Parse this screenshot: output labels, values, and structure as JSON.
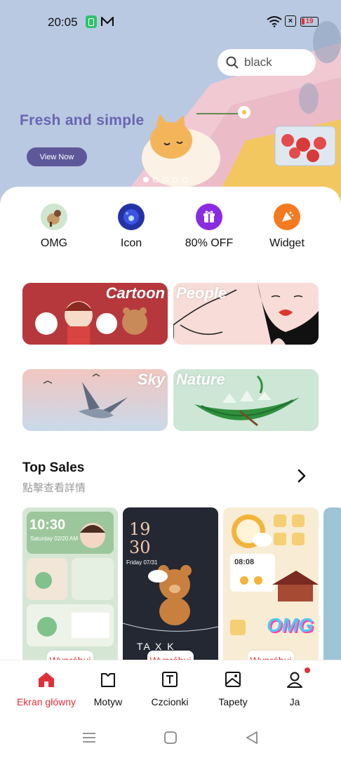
{
  "status_bar": {
    "time": "20:05",
    "battery": "19"
  },
  "search": {
    "query": "black"
  },
  "banner": {
    "title": "Fresh and simple",
    "button": "View Now",
    "dots": 5,
    "active_dot": 0
  },
  "quick_entries": [
    {
      "label": "OMG",
      "icon": "omg-avatar-icon"
    },
    {
      "label": "Icon",
      "icon": "icon-pack-icon"
    },
    {
      "label": "80% OFF",
      "icon": "gift-icon"
    },
    {
      "label": "Widget",
      "icon": "widget-icon"
    }
  ],
  "categories": [
    {
      "label": "Cartoon"
    },
    {
      "label": "People"
    },
    {
      "label": "Sky"
    },
    {
      "label": "Nature"
    }
  ],
  "top_sales": {
    "title": "Top Sales",
    "subtitle": "點擊查看詳情",
    "cards": [
      {
        "time": "10:30",
        "date": "Saturday 02/20 AM",
        "try_label": "Wypróbuj"
      },
      {
        "time_line1": "19",
        "time_line2": "30",
        "date": "Friday 07/31",
        "brand": "TA   X K",
        "try_label": "Wypróbuj"
      },
      {
        "time": "08:08",
        "badge": "OMG",
        "try_label": "Wypróbuj"
      }
    ]
  },
  "bottom_nav": {
    "items": [
      {
        "label": "Ekran główny",
        "icon": "home-icon",
        "active": true
      },
      {
        "label": "Motyw",
        "icon": "theme-icon",
        "active": false
      },
      {
        "label": "Czcionki",
        "icon": "font-icon",
        "active": false
      },
      {
        "label": "Tapety",
        "icon": "wallpaper-icon",
        "active": false
      },
      {
        "label": "Ja",
        "icon": "profile-icon",
        "active": false,
        "badge": true
      }
    ]
  },
  "colors": {
    "accent": "#e0303a",
    "banner_bg": "#b9c9e2",
    "banner_title": "#6a64b0",
    "banner_button": "#5e5899"
  }
}
